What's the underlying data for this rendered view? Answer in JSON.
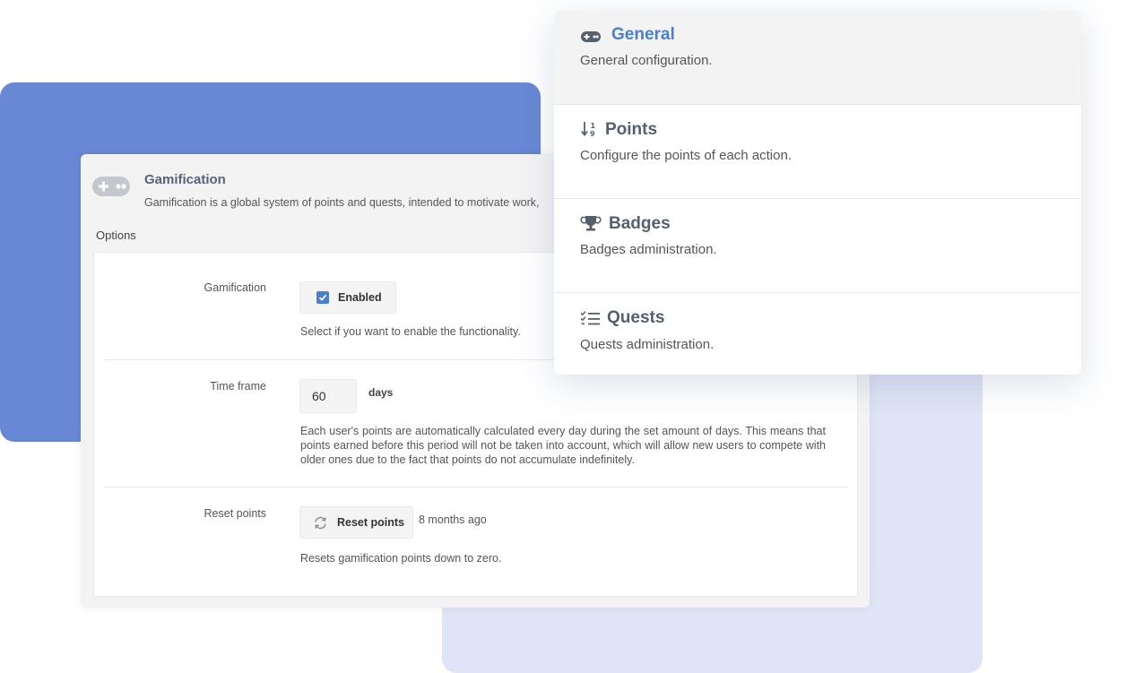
{
  "panel": {
    "title": "Gamification",
    "description": "Gamification is a global system of points and quests, intended to motivate work,",
    "section_label": "Options"
  },
  "settings": {
    "gamification": {
      "label": "Gamification",
      "toggle_label": "Enabled",
      "checked": true,
      "hint": "Select if you want to enable the functionality."
    },
    "time_frame": {
      "label": "Time frame",
      "value": "60",
      "unit": "days",
      "hint": "Each user's points are automatically calculated every day during the set amount of days. This means that points earned before this period will not be taken into account, which will allow new users to compete with older ones due to the fact that points do not accumulate indefinitely."
    },
    "reset_points": {
      "label": "Reset points",
      "button_label": "Reset points",
      "last_reset": "8 months ago",
      "hint": "Resets gamification points down to zero."
    }
  },
  "menu": {
    "items": [
      {
        "icon": "gamepad-icon",
        "title": "General",
        "description": "General configuration.",
        "active": true
      },
      {
        "icon": "sort-numeric-icon",
        "title": "Points",
        "description": "Configure the points of each action.",
        "active": false
      },
      {
        "icon": "trophy-icon",
        "title": "Badges",
        "description": "Badges administration.",
        "active": false
      },
      {
        "icon": "checklist-icon",
        "title": "Quests",
        "description": "Quests administration.",
        "active": false
      }
    ]
  },
  "colors": {
    "accent": "#4a7fd0",
    "backdrop_blue": "#6888d6",
    "backdrop_lavender": "#dfe4f6",
    "menu_title": "#55606f"
  }
}
